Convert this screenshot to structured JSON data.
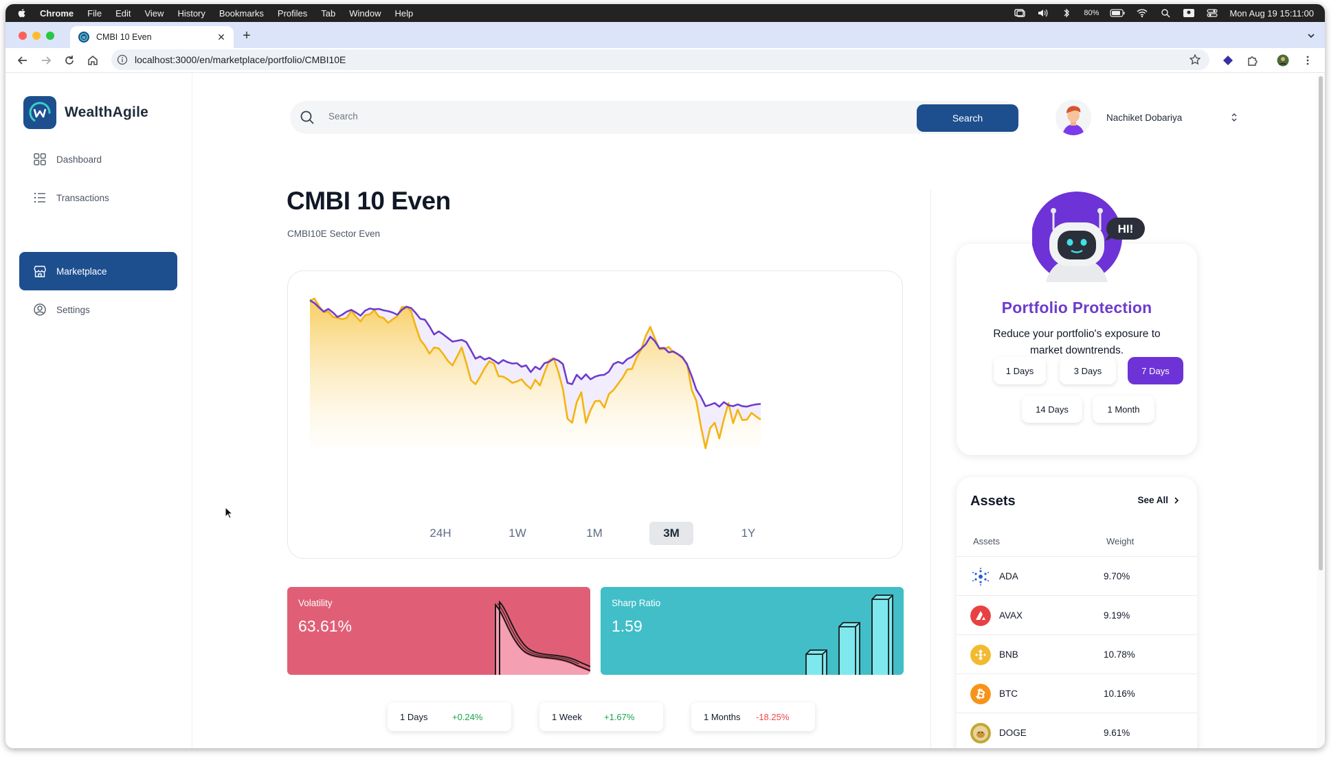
{
  "menubar": {
    "app": "Chrome",
    "items": [
      "File",
      "Edit",
      "View",
      "History",
      "Bookmarks",
      "Profiles",
      "Tab",
      "Window",
      "Help"
    ],
    "battery": "80%",
    "datetime": "Mon Aug 19  15:11:00"
  },
  "browser": {
    "tab_title": "CMBI 10 Even",
    "url": "localhost:3000/en/marketplace/portfolio/CMBI10E"
  },
  "sidebar": {
    "brand": "WealthAgile",
    "items": [
      {
        "label": "Dashboard",
        "icon": "grid-icon"
      },
      {
        "label": "Transactions",
        "icon": "list-icon"
      },
      {
        "label": "Marketplace",
        "icon": "store-icon",
        "active": true
      },
      {
        "label": "Settings",
        "icon": "user-circle-icon"
      }
    ]
  },
  "header": {
    "search_placeholder": "Search",
    "search_button": "Search",
    "user_name": "Nachiket Dobariya"
  },
  "portfolio": {
    "title": "CMBI 10 Even",
    "subtitle": "CMBI10E Sector Even"
  },
  "chart_data": {
    "type": "line",
    "series_colors": [
      "#6d3ccc",
      "#f4b30f"
    ],
    "ranges": [
      "24H",
      "1W",
      "1M",
      "3M",
      "1Y"
    ],
    "active_range": "3M",
    "series": [
      {
        "values": [
          100,
          99.4,
          98.4,
          97.5,
          98.1,
          97.3,
          96.3,
          96.8,
          97.5,
          97.9,
          97.3,
          96.6,
          97.7,
          98.2,
          98.0,
          98.1,
          97.8,
          97.6,
          97.3,
          96.8,
          97.9,
          98.6,
          98.3,
          97.2,
          95.9,
          95.7,
          94.2,
          92.4,
          93.1,
          92.4,
          91.6,
          90.8,
          91.0,
          91.2,
          90.7,
          88.9,
          87.0,
          87.5,
          86.8,
          87.2,
          86.6,
          85.9,
          86.7,
          86.2,
          85.9,
          86.0,
          85.2,
          85.5,
          84.0,
          85.2,
          84.6,
          86.0,
          86.3,
          87.0,
          86.6,
          85.8,
          81.6,
          81.3,
          83.4,
          82.4,
          83.5,
          82.4,
          83.0,
          83.3,
          83.4,
          84.1,
          85.8,
          86.3,
          85.9,
          86.9,
          87.4,
          88.3,
          89.2,
          90.2,
          91.9,
          90.9,
          89.3,
          89.4,
          88.4,
          88.6,
          88.0,
          87.3,
          85.7,
          83.1,
          80.1,
          78.5,
          76.4,
          76.7,
          77.1,
          76.3,
          77.3,
          76.6,
          76.4,
          76.8,
          76.4,
          76.3,
          76.6,
          76.8,
          76.9
        ]
      },
      {
        "values": [
          100,
          100.4,
          98.7,
          97.4,
          97.5,
          96.3,
          96.1,
          95.8,
          96.1,
          97.7,
          96.4,
          95.3,
          96.7,
          96.9,
          97.8,
          96.4,
          96.1,
          95.0,
          95.8,
          96.5,
          98.5,
          98.6,
          97.6,
          94.2,
          91.2,
          89.9,
          88.1,
          89.5,
          89.3,
          88.0,
          86.5,
          85.5,
          87.5,
          89.5,
          86.0,
          82.2,
          81.3,
          83.0,
          84.9,
          86.4,
          85.9,
          83.1,
          83.0,
          82.4,
          81.6,
          81.9,
          82.4,
          81.2,
          80.3,
          82.3,
          81.0,
          83.9,
          86.6,
          87.1,
          84.1,
          80.2,
          73.6,
          72.7,
          77.3,
          79.5,
          72.7,
          75.5,
          77.5,
          77.6,
          76.1,
          79.1,
          80.0,
          81.4,
          82.8,
          84.6,
          84.7,
          87.2,
          89.0,
          92.1,
          94.1,
          91.5,
          89.1,
          89.2,
          89.6,
          88.5,
          88.0,
          87.1,
          85.9,
          80.0,
          77.6,
          71.9,
          67.0,
          71.5,
          72.7,
          69.2,
          73.5,
          77.1,
          72.6,
          75.6,
          73.3,
          73.4,
          74.9,
          74.1,
          73.4
        ]
      }
    ]
  },
  "metrics": {
    "volatility": {
      "label": "Volatility",
      "value": "63.61%"
    },
    "sharp_ratio": {
      "label": "Sharp Ratio",
      "value": "1.59"
    }
  },
  "performance": [
    {
      "period": "1 Days",
      "change": "+0.24%",
      "direction": "up"
    },
    {
      "period": "1 Week",
      "change": "+1.67%",
      "direction": "up"
    },
    {
      "period": "1 Months",
      "change": "-18.25%",
      "direction": "down"
    }
  ],
  "protection": {
    "bubble": "HI!",
    "title": "Portfolio Protection",
    "description": "Reduce your portfolio's exposure to market downtrends.",
    "options": [
      "1 Days",
      "3 Days",
      "7 Days",
      "14 Days",
      "1 Month"
    ],
    "selected": "7 Days"
  },
  "assets": {
    "title": "Assets",
    "see_all": "See All",
    "columns": [
      "Assets",
      "Weight"
    ],
    "rows": [
      {
        "symbol": "ADA",
        "weight": "9.70%",
        "color": "#2a5bd7"
      },
      {
        "symbol": "AVAX",
        "weight": "9.19%",
        "color": "#e84142"
      },
      {
        "symbol": "BNB",
        "weight": "10.78%",
        "color": "#f3ba2f"
      },
      {
        "symbol": "BTC",
        "weight": "10.16%",
        "color": "#f7931a"
      },
      {
        "symbol": "DOGE",
        "weight": "9.61%",
        "color": "#c2a633"
      }
    ]
  }
}
